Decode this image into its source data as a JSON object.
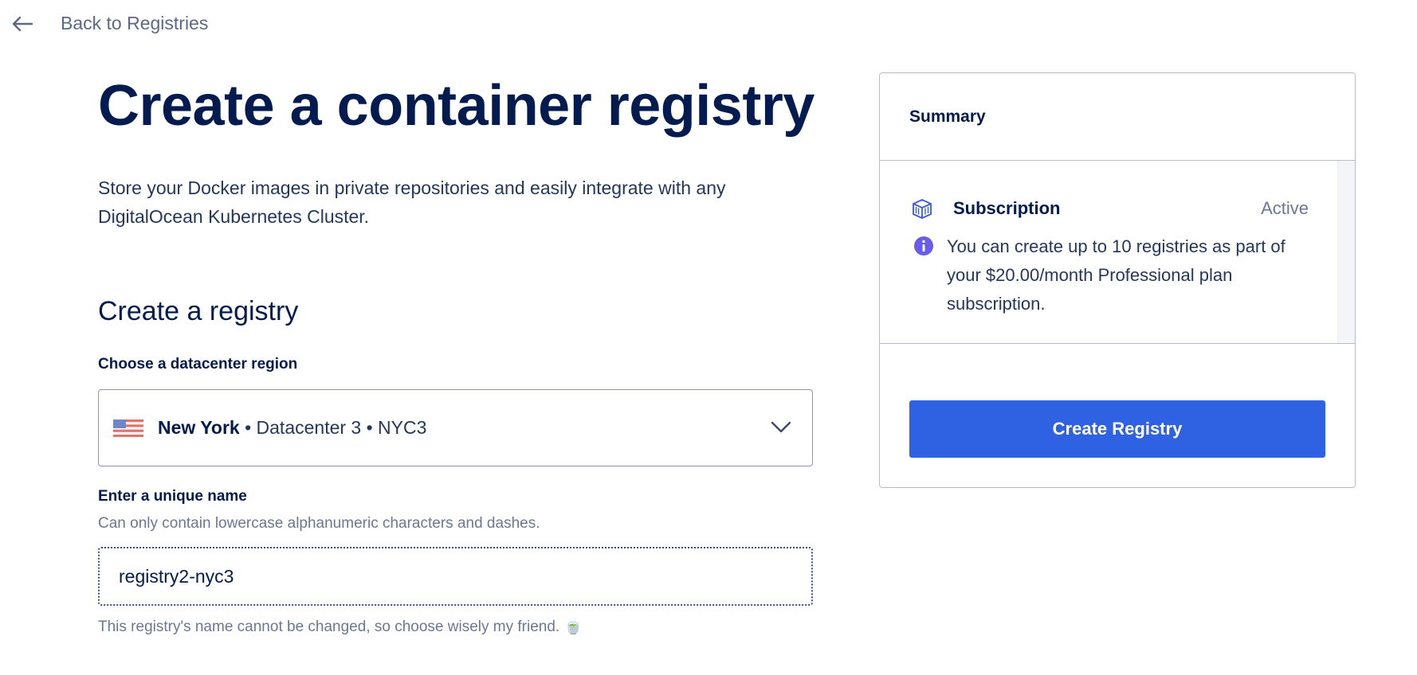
{
  "nav": {
    "back_label": "Back to Registries"
  },
  "page": {
    "title": "Create a container registry",
    "description": "Store your Docker images in private repositories and easily integrate with any DigitalOcean Kubernetes Cluster."
  },
  "form": {
    "section_title": "Create a registry",
    "region": {
      "label": "Choose a datacenter region",
      "selected_name": "New York",
      "selected_detail": " • Datacenter 3 • NYC3"
    },
    "name": {
      "label": "Enter a unique name",
      "help": "Can only contain lowercase alphanumeric characters and dashes.",
      "value": "registry2-nyc3",
      "hint": "This registry's name cannot be changed, so choose wisely my friend. 🍵"
    }
  },
  "summary": {
    "title": "Summary",
    "subscription_label": "Subscription",
    "subscription_status": "Active",
    "info_text": "You can create up to 10 registries as part of your $20.00/month Professional plan subscription.",
    "create_button": "Create Registry"
  },
  "colors": {
    "primary": "#2f62e3",
    "heading": "#031b4e",
    "muted": "#6b7894",
    "info_icon": "#6b5ce7"
  },
  "icons": {
    "back": "arrow-left-icon",
    "flag": "us-flag-icon",
    "dropdown": "chevron-down-icon",
    "subscription": "container-icon",
    "info": "info-icon"
  }
}
